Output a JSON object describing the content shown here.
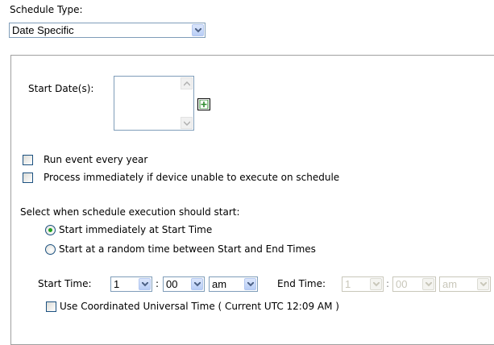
{
  "schedule_type": {
    "label": "Schedule Type:",
    "selected": "Date Specific"
  },
  "start_dates": {
    "label": "Start Date(s):"
  },
  "options": {
    "run_every_year": "Run event every year",
    "process_immediately": "Process immediately if device unable to execute on schedule"
  },
  "execution": {
    "label": "Select when schedule execution should start:",
    "option_immediate": "Start immediately at Start Time",
    "option_random": "Start at a random time between Start and End Times",
    "selected": "immediate"
  },
  "time": {
    "start_label": "Start Time:",
    "start_hour": "1",
    "start_minute": "00",
    "start_ampm": "am",
    "colon": ":",
    "end_label": "End Time:",
    "end_hour": "1",
    "end_minute": "00",
    "end_ampm": "am",
    "utc_label": "Use Coordinated Universal Time ( Current UTC 12:09 AM )"
  },
  "colors": {
    "border": "#7f9db9",
    "radio_dot": "#21a121",
    "add_icon": "#2e8b2e"
  }
}
